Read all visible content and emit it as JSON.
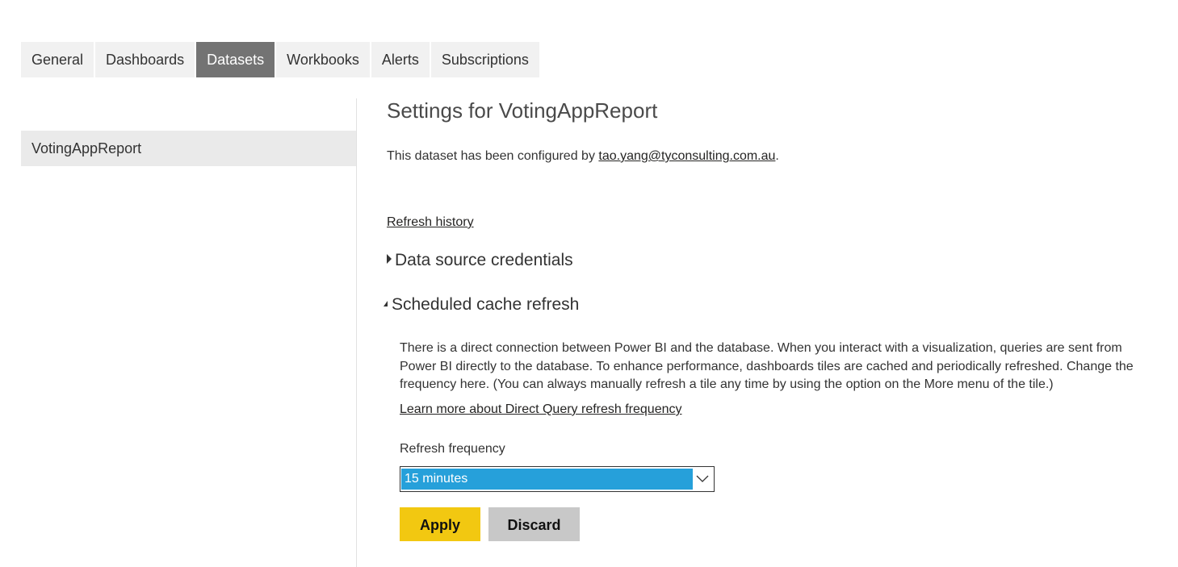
{
  "tabs": [
    {
      "label": "General",
      "active": false
    },
    {
      "label": "Dashboards",
      "active": false
    },
    {
      "label": "Datasets",
      "active": true
    },
    {
      "label": "Workbooks",
      "active": false
    },
    {
      "label": "Alerts",
      "active": false
    },
    {
      "label": "Subscriptions",
      "active": false
    }
  ],
  "sidebar": {
    "items": [
      {
        "label": "VotingAppReport",
        "selected": true
      }
    ]
  },
  "main": {
    "title": "Settings for VotingAppReport",
    "configured_prefix": "This dataset has been configured by ",
    "configured_email": "tao.yang@tyconsulting.com.au",
    "configured_suffix": ".",
    "refresh_history_link": "Refresh history",
    "sections": {
      "credentials": {
        "label": "Data source credentials",
        "expanded": false,
        "icon": "caret-right-icon"
      },
      "cache_refresh": {
        "label": "Scheduled cache refresh",
        "expanded": true,
        "icon": "caret-down-icon"
      }
    },
    "description": "There is a direct connection between Power BI and the database. When you interact with a visualization, queries are sent from Power BI directly to the database. To enhance performance, dashboards tiles are cached and periodically refreshed. Change the frequency here. (You can always manually refresh a tile any time by using the option on the More menu of the tile.)",
    "learn_more_link": "Learn more about Direct Query refresh frequency",
    "frequency_label": "Refresh frequency",
    "frequency_value": "15 minutes",
    "apply_label": "Apply",
    "discard_label": "Discard"
  },
  "colors": {
    "active_tab": "#737373",
    "tab_bg": "#f1f1f1",
    "sidebar_selected": "#eaeaea",
    "select_highlight": "#26a0da",
    "apply_button": "#f2c811",
    "discard_button": "#c8c8c8"
  }
}
